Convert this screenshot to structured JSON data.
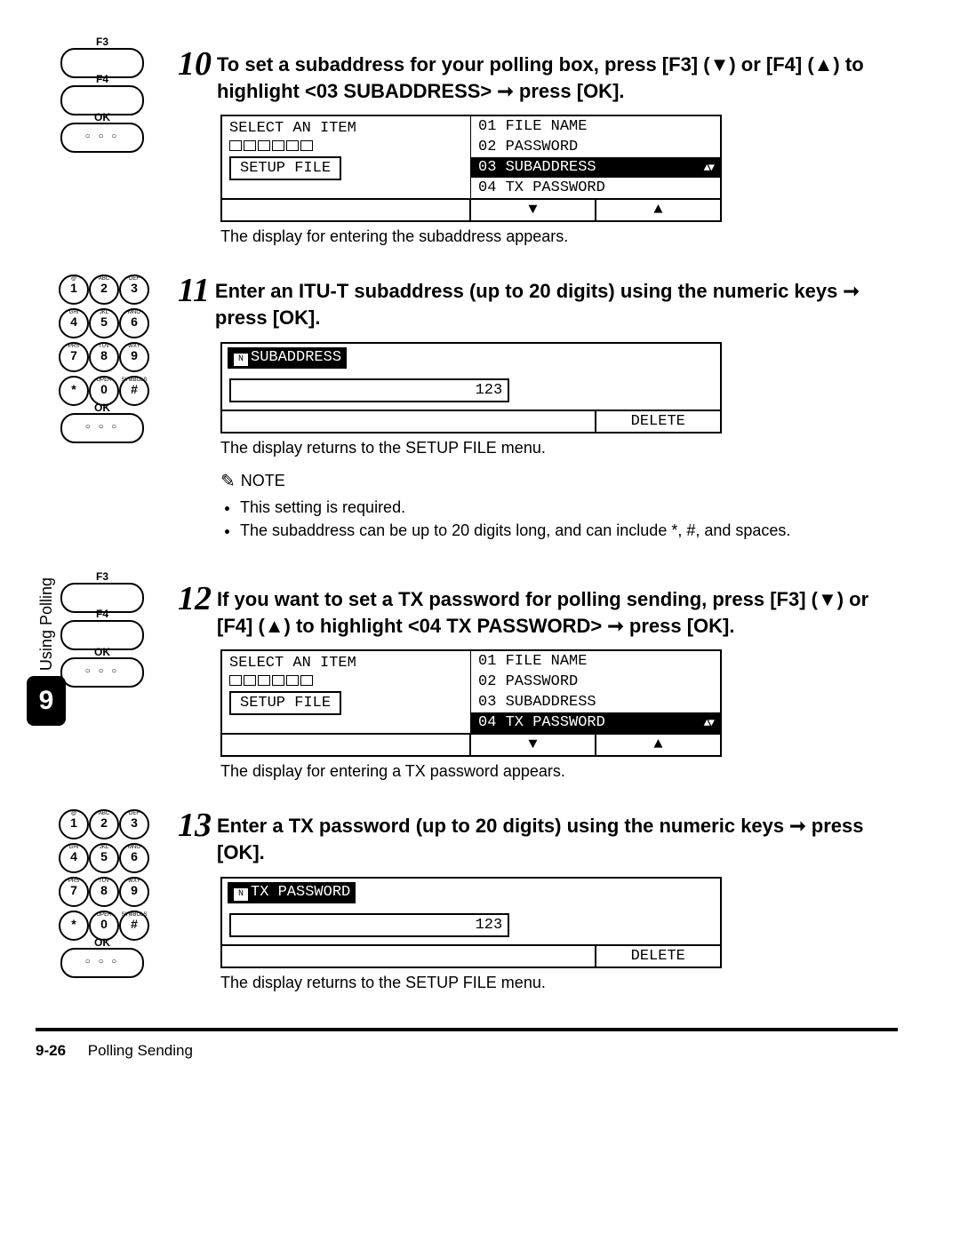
{
  "sideTab": {
    "label": "Using Polling",
    "number": "9"
  },
  "steps": {
    "s10": {
      "num": "10",
      "title": "To set a subaddress for your polling box, press [F3] (▼) or [F4] (▲) to highlight <03 SUBADDRESS> ➞ press [OK].",
      "lcd": {
        "leftTitle": "SELECT AN ITEM",
        "leftBox": "SETUP FILE",
        "options": [
          "01 FILE NAME",
          "02 PASSWORD",
          "03 SUBADDRESS",
          "04 TX PASSWORD"
        ],
        "selectedIndex": 2,
        "bottom": [
          "▼",
          "▲"
        ]
      },
      "caption": "The display for entering the subaddress appears."
    },
    "s11": {
      "num": "11",
      "title": "Enter an ITU-T subaddress (up to 20 digits) using the numeric keys ➞ press [OK].",
      "lcd": {
        "header": "SUBADDRESS",
        "inputValue": "123",
        "bottomRight": "DELETE"
      },
      "caption": "The display returns to the SETUP FILE menu."
    },
    "note": {
      "label": "NOTE",
      "items": [
        "This setting is required.",
        "The subaddress can be up to 20 digits long, and can include *, #, and spaces."
      ]
    },
    "s12": {
      "num": "12",
      "title": "If you want to set a TX password for polling sending, press [F3] (▼) or [F4] (▲) to highlight <04 TX PASSWORD> ➞ press [OK].",
      "lcd": {
        "leftTitle": "SELECT AN ITEM",
        "leftBox": "SETUP FILE",
        "options": [
          "01 FILE NAME",
          "02 PASSWORD",
          "03 SUBADDRESS",
          "04 TX PASSWORD"
        ],
        "selectedIndex": 3,
        "bottom": [
          "▼",
          "▲"
        ]
      },
      "caption": "The display for entering a TX password appears."
    },
    "s13": {
      "num": "13",
      "title": "Enter a TX password (up to 20 digits) using the numeric keys ➞ press [OK].",
      "lcd": {
        "header": "TX PASSWORD",
        "inputValue": "123",
        "bottomRight": "DELETE"
      },
      "caption": "The display returns to the SETUP FILE menu."
    }
  },
  "buttons": {
    "f3": "F3",
    "f4": "F4",
    "ok": "OK"
  },
  "keypad": {
    "keys": [
      "1",
      "2",
      "3",
      "4",
      "5",
      "6",
      "7",
      "8",
      "9",
      "*",
      "0",
      "#"
    ],
    "labels": [
      "@",
      "ABC",
      "DEF",
      "GHI",
      "JKL",
      "MNO",
      "PRS",
      "TUV",
      "WXY",
      "",
      "OPER",
      "SYMBOLS"
    ]
  },
  "footer": {
    "page": "9-26",
    "section": "Polling Sending"
  }
}
